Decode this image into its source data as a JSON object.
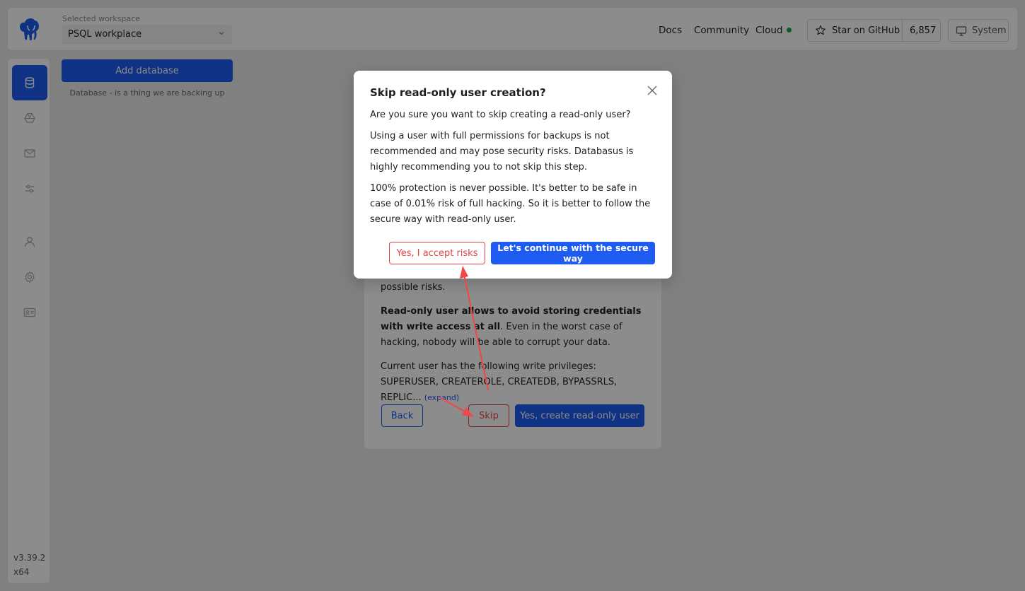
{
  "header": {
    "workspace_label": "Selected workspace",
    "workspace_value": "PSQL workplace",
    "nav": {
      "docs": "Docs",
      "community": "Community",
      "cloud": "Cloud"
    },
    "github_label": "Star on GitHub",
    "github_count": "6,857",
    "theme_label": "System",
    "cloud_status_color": "#1aa64a"
  },
  "sidebar": {
    "items": [
      {
        "icon": "database-icon",
        "active": true
      },
      {
        "icon": "storage-icon"
      },
      {
        "icon": "mail-icon"
      },
      {
        "icon": "sliders-icon"
      },
      {
        "icon": "user-icon"
      },
      {
        "icon": "gear-icon"
      },
      {
        "icon": "id-card-icon"
      }
    ],
    "version": "v3.39.2",
    "arch": "x64"
  },
  "main": {
    "add_database_label": "Add database",
    "hint": "Database - is a thing we are backing up"
  },
  "wizard": {
    "partial_line": "possible risks.",
    "bold_text": "Read-only user allows to avoid storing credentials with write access at all",
    "rest_text": ". Even in the worst case of hacking, nobody will be able to corrupt your data.",
    "privileges_text": "Current user has the following write privileges: SUPERUSER, CREATEROLE, CREATEDB, BYPASSRLS, REPLIC...",
    "expand_label": "(expand)",
    "back_label": "Back",
    "skip_label": "Skip",
    "create_label": "Yes, create read-only user"
  },
  "modal": {
    "title": "Skip read-only user creation?",
    "p1": "Are you sure you want to skip creating a read-only user?",
    "p2": "Using a user with full permissions for backups is not recommended and may pose security risks. Databasus is highly recommending you to not skip this step.",
    "p3": "100% protection is never possible. It's better to be safe in case of 0.01% risk of full hacking. So it is better to follow the secure way with read-only user.",
    "accept_label": "Yes, I accept risks",
    "secure_label": "Let's continue with the secure way"
  },
  "colors": {
    "primary": "#1e5bf0",
    "danger": "#e04545",
    "annotation": "#f04848"
  }
}
